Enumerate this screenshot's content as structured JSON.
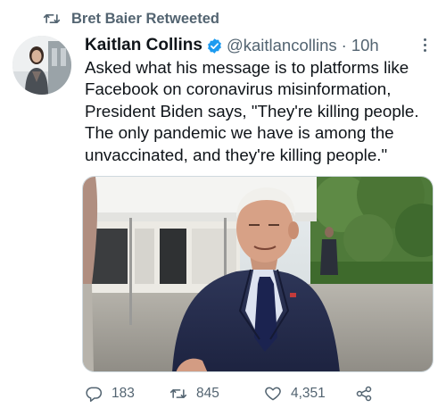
{
  "retweet_context": {
    "text": "Bret Baier Retweeted",
    "icon": "retweet-icon"
  },
  "author": {
    "name": "Kaitlan Collins",
    "verified": true,
    "handle": "@kaitlancollins",
    "separator": "·",
    "time": "10h",
    "avatar": "avatar-photo"
  },
  "tweet": {
    "text": "Asked what his message is to platforms like\nFacebook on coronavirus misinformation,\nPresident Biden says, \"They're killing people.\nThe only pandemic we have is among the\nunvaccinated, and they're killing people.\""
  },
  "media": {
    "type": "photo"
  },
  "actions": {
    "replies": "183",
    "retweets": "845",
    "likes": "4,351",
    "icons": [
      "reply-icon",
      "retweet-icon",
      "like-icon",
      "share-icon"
    ]
  },
  "colors": {
    "text": "#0f1419",
    "secondary": "#536471",
    "verified": "#1d9bf0"
  }
}
